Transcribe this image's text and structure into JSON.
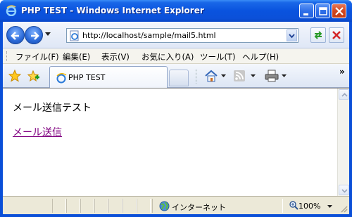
{
  "window": {
    "title": "PHP TEST - Windows Internet Explorer",
    "title_bar_color": "#0a53de",
    "buttons": [
      "minimize-icon",
      "maximize-icon",
      "close-icon"
    ]
  },
  "address_bar": {
    "url": "http://localhost/sample/mail5.html"
  },
  "menu": {
    "items": [
      {
        "label": "ファイル(F)"
      },
      {
        "label": "編集(E)"
      },
      {
        "label": "表示(V)"
      },
      {
        "label": "お気に入り(A)"
      },
      {
        "label": "ツール(T)"
      },
      {
        "label": "ヘルプ(H)"
      }
    ]
  },
  "tabs": {
    "active_label": "PHP TEST",
    "overflow": "»"
  },
  "content": {
    "heading": "メール送信テスト",
    "link": "メール送信",
    "link_color": "#800080"
  },
  "status": {
    "zone": "インターネット",
    "zoom": "100%"
  }
}
